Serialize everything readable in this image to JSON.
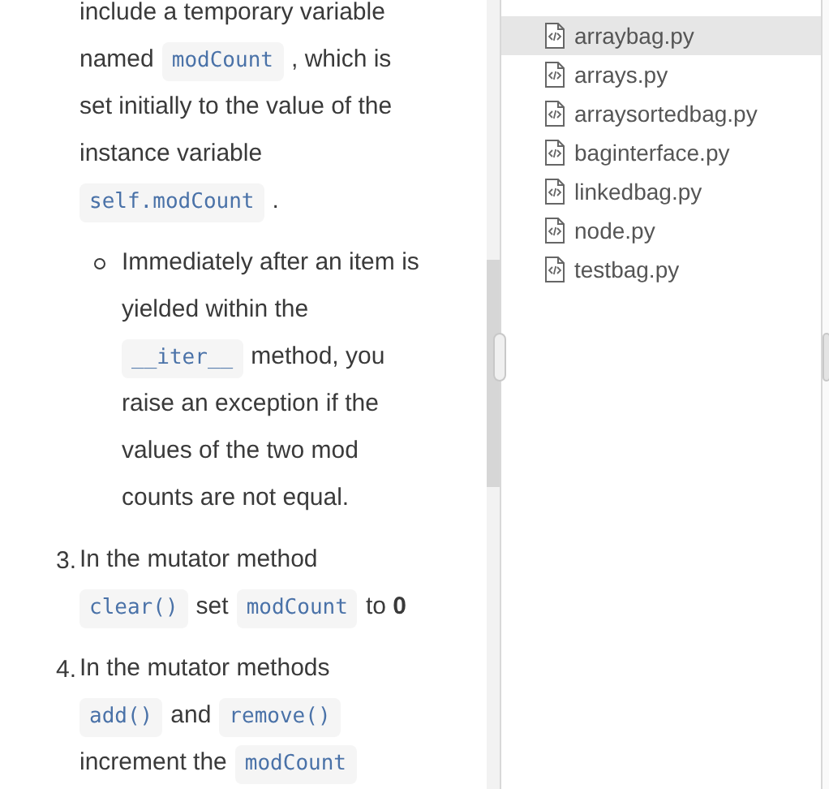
{
  "instructions": [
    {
      "kind": "continuation",
      "lines": [
        [
          {
            "kind": "text",
            "text": "include a temporary variable"
          }
        ],
        [
          {
            "kind": "text",
            "text": "named"
          },
          {
            "kind": "code",
            "text": "modCount"
          },
          {
            "kind": "text",
            "text": ", which is"
          }
        ],
        [
          {
            "kind": "text",
            "text": "set initially to the value of the"
          }
        ],
        [
          {
            "kind": "text",
            "text": "instance variable"
          }
        ],
        [
          {
            "kind": "code",
            "text": "self.modCount"
          },
          {
            "kind": "text",
            "text": "."
          }
        ]
      ]
    },
    {
      "kind": "sub_bullet",
      "lines": [
        [
          {
            "kind": "text",
            "text": "Immediately after an item is"
          }
        ],
        [
          {
            "kind": "text",
            "text": "yielded within the"
          }
        ],
        [
          {
            "kind": "code",
            "text": "__iter__"
          },
          {
            "kind": "text",
            "text": "method, you"
          }
        ],
        [
          {
            "kind": "text",
            "text": "raise an exception if the"
          }
        ],
        [
          {
            "kind": "text",
            "text": "values of the two mod"
          }
        ],
        [
          {
            "kind": "text",
            "text": "counts are not equal."
          }
        ]
      ]
    },
    {
      "kind": "numbered",
      "number": "3.",
      "lines": [
        [
          {
            "kind": "text",
            "text": "In the mutator method"
          }
        ],
        [
          {
            "kind": "code",
            "text": "clear()"
          },
          {
            "kind": "text",
            "text": "set"
          },
          {
            "kind": "code",
            "text": "modCount"
          },
          {
            "kind": "text",
            "text": "to **0**"
          }
        ]
      ]
    },
    {
      "kind": "numbered",
      "number": "4.",
      "lines": [
        [
          {
            "kind": "text",
            "text": "In the mutator methods"
          }
        ],
        [
          {
            "kind": "code",
            "text": "add()"
          },
          {
            "kind": "text",
            "text": "and"
          },
          {
            "kind": "code",
            "text": "remove()"
          }
        ],
        [
          {
            "kind": "text",
            "text": "increment the"
          },
          {
            "kind": "code",
            "text": "modCount"
          }
        ]
      ]
    }
  ],
  "files": [
    {
      "name": "arraybag.py",
      "selected": true
    },
    {
      "name": "arrays.py",
      "selected": false
    },
    {
      "name": "arraysortedbag.py",
      "selected": false
    },
    {
      "name": "baginterface.py",
      "selected": false
    },
    {
      "name": "linkedbag.py",
      "selected": false
    },
    {
      "name": "node.py",
      "selected": false
    },
    {
      "name": "testbag.py",
      "selected": false
    }
  ]
}
